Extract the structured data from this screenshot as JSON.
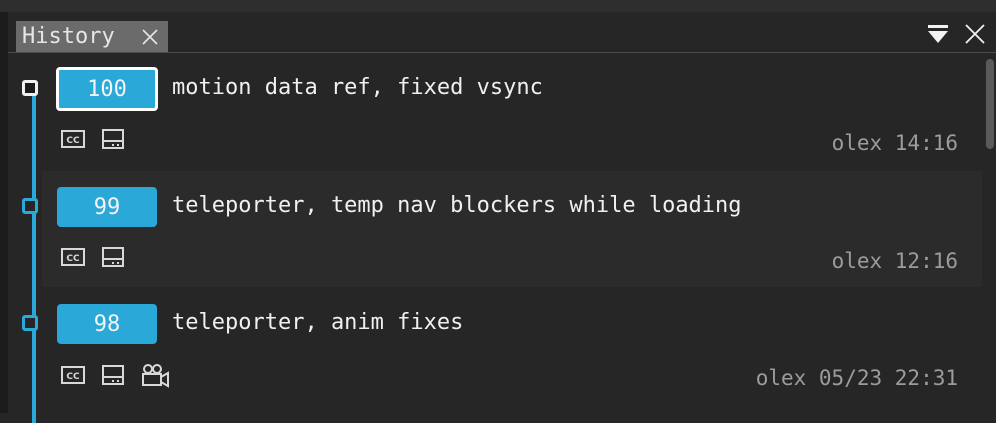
{
  "panel": {
    "tab_label": "History"
  },
  "entries": [
    {
      "id": "100",
      "message": "motion data ref, fixed vsync",
      "author": "olex",
      "time": "14:16",
      "meta": "olex 14:16",
      "icons": [
        "cc-icon",
        "layout-icon"
      ],
      "active": true
    },
    {
      "id": "99",
      "message": "teleporter, temp nav blockers while loading",
      "author": "olex",
      "time": "12:16",
      "meta": "olex 12:16",
      "icons": [
        "cc-icon",
        "layout-icon"
      ],
      "active": false
    },
    {
      "id": "98",
      "message": "teleporter, anim fixes",
      "author": "olex",
      "time": "05/23 22:31",
      "meta": "olex 05/23 22:31",
      "icons": [
        "cc-icon",
        "layout-icon",
        "camera-icon"
      ],
      "active": false
    }
  ],
  "colors": {
    "accent": "#2aa8d8",
    "background": "#262626",
    "text": "#f0f0f0",
    "meta_text": "#9c9c9c"
  }
}
